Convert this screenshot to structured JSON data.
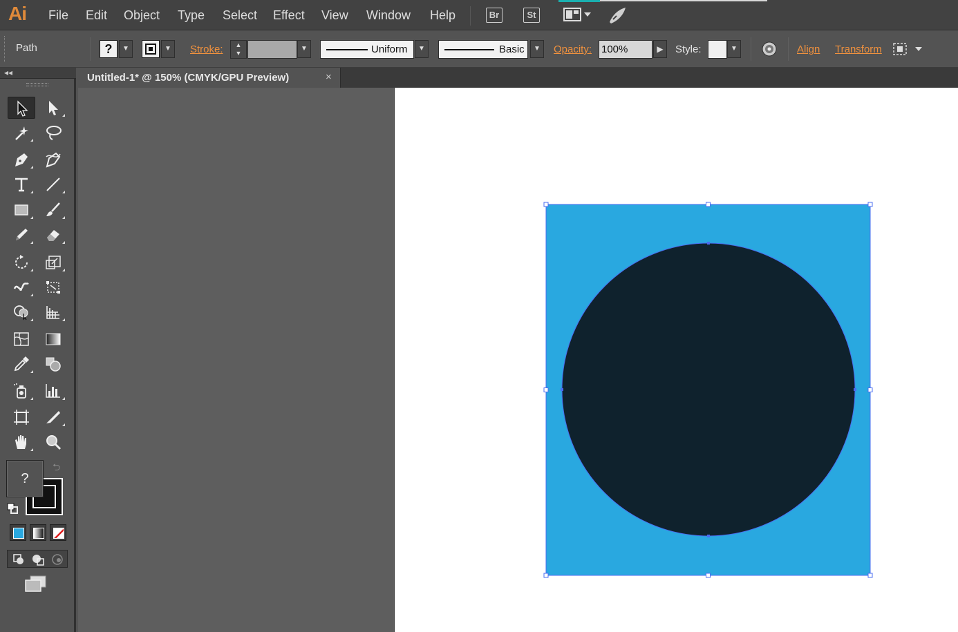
{
  "app": {
    "logo": "Ai",
    "menu": [
      "File",
      "Edit",
      "Object",
      "Type",
      "Select",
      "Effect",
      "View",
      "Window",
      "Help"
    ],
    "bridge_label": "Br",
    "stock_label": "St"
  },
  "control_bar": {
    "selection_type": "Path",
    "fill_label": "?",
    "stroke_label": "Stroke:",
    "variable_width": "Uniform",
    "brush": "Basic",
    "opacity_label": "Opacity:",
    "opacity_value": "100%",
    "style_label": "Style:",
    "align_label": "Align",
    "transform_label": "Transform"
  },
  "tools_panel": {
    "fill_indicator": "?",
    "tools": [
      "selection-tool",
      "direct-selection-tool",
      "magic-wand-tool",
      "lasso-tool",
      "pen-tool",
      "curvature-tool",
      "type-tool",
      "line-segment-tool",
      "rectangle-tool",
      "paintbrush-tool",
      "pencil-tool",
      "eraser-tool",
      "rotate-tool",
      "scale-tool",
      "width-tool",
      "free-transform-tool",
      "shape-builder-tool",
      "perspective-grid-tool",
      "mesh-tool",
      "gradient-tool",
      "eyedropper-tool",
      "blend-tool",
      "symbol-sprayer-tool",
      "column-graph-tool",
      "artboard-tool",
      "slice-tool",
      "hand-tool",
      "zoom-tool"
    ]
  },
  "document": {
    "tab_title": "Untitled-1* @ 150% (CMYK/GPU Preview)",
    "close_label": "×"
  },
  "artwork": {
    "square_color": "#29a8e0",
    "circle_color": "#0f222d",
    "selection_color": "#4a6cf0"
  },
  "colors": {
    "accent": "#f0913e",
    "logo": "#e08a3a"
  }
}
